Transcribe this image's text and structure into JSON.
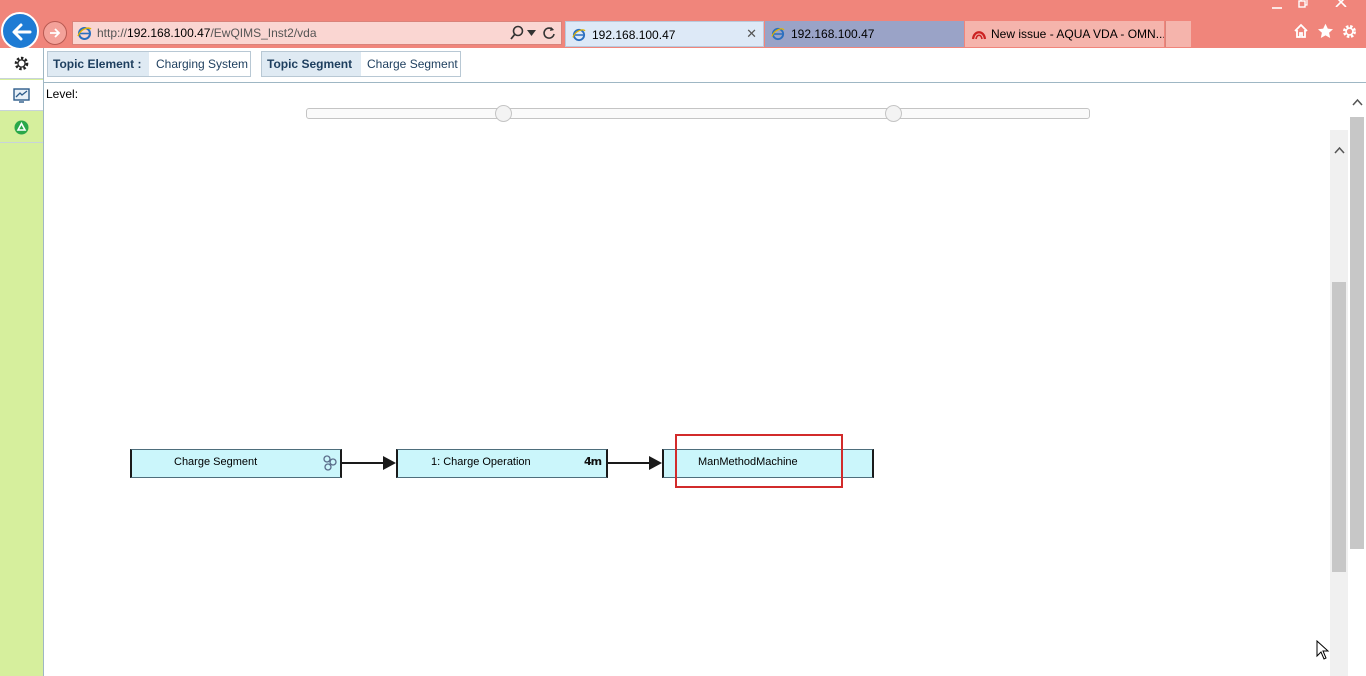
{
  "browser": {
    "url_prefix": "http://",
    "url_host": "192.168.100.47",
    "url_path": "/EwQIMS_Inst2/vda",
    "tabs": [
      {
        "label": "192.168.100.47"
      },
      {
        "label": "192.168.100.47"
      },
      {
        "label": "New issue - AQUA VDA - OMN..."
      }
    ],
    "close_glyph": "✕"
  },
  "icons": {
    "back": "back-arrow-icon",
    "forward": "forward-arrow-icon",
    "search": "search-icon",
    "refresh": "refresh-icon",
    "home": "home-icon",
    "favorites": "star-icon",
    "settings": "gear-icon"
  },
  "rail": {
    "items": [
      {
        "icon": "settings-icon"
      },
      {
        "icon": "monitor-icon"
      },
      {
        "icon": "recycle-icon"
      }
    ]
  },
  "topic": {
    "element_key": "Topic Element :",
    "element_value": "Charging System",
    "segment_key": "Topic Segment",
    "segment_value": "Charge Segment"
  },
  "level": {
    "label": "Level:"
  },
  "diagram": {
    "nodes": [
      {
        "label": "Charge Segment",
        "icon": "segment-icon"
      },
      {
        "label": "1: Charge Operation",
        "icon": "4m-icon",
        "icon_text": "4m"
      },
      {
        "label": "ManMethodMachine",
        "icon": "",
        "highlighted": true
      }
    ]
  },
  "colors": {
    "chrome": "#f0857b",
    "rail": "#d6ef9d",
    "node_fill": "#cbf6fb",
    "highlight": "#d22b2b",
    "back_button": "#1e7bd4"
  }
}
